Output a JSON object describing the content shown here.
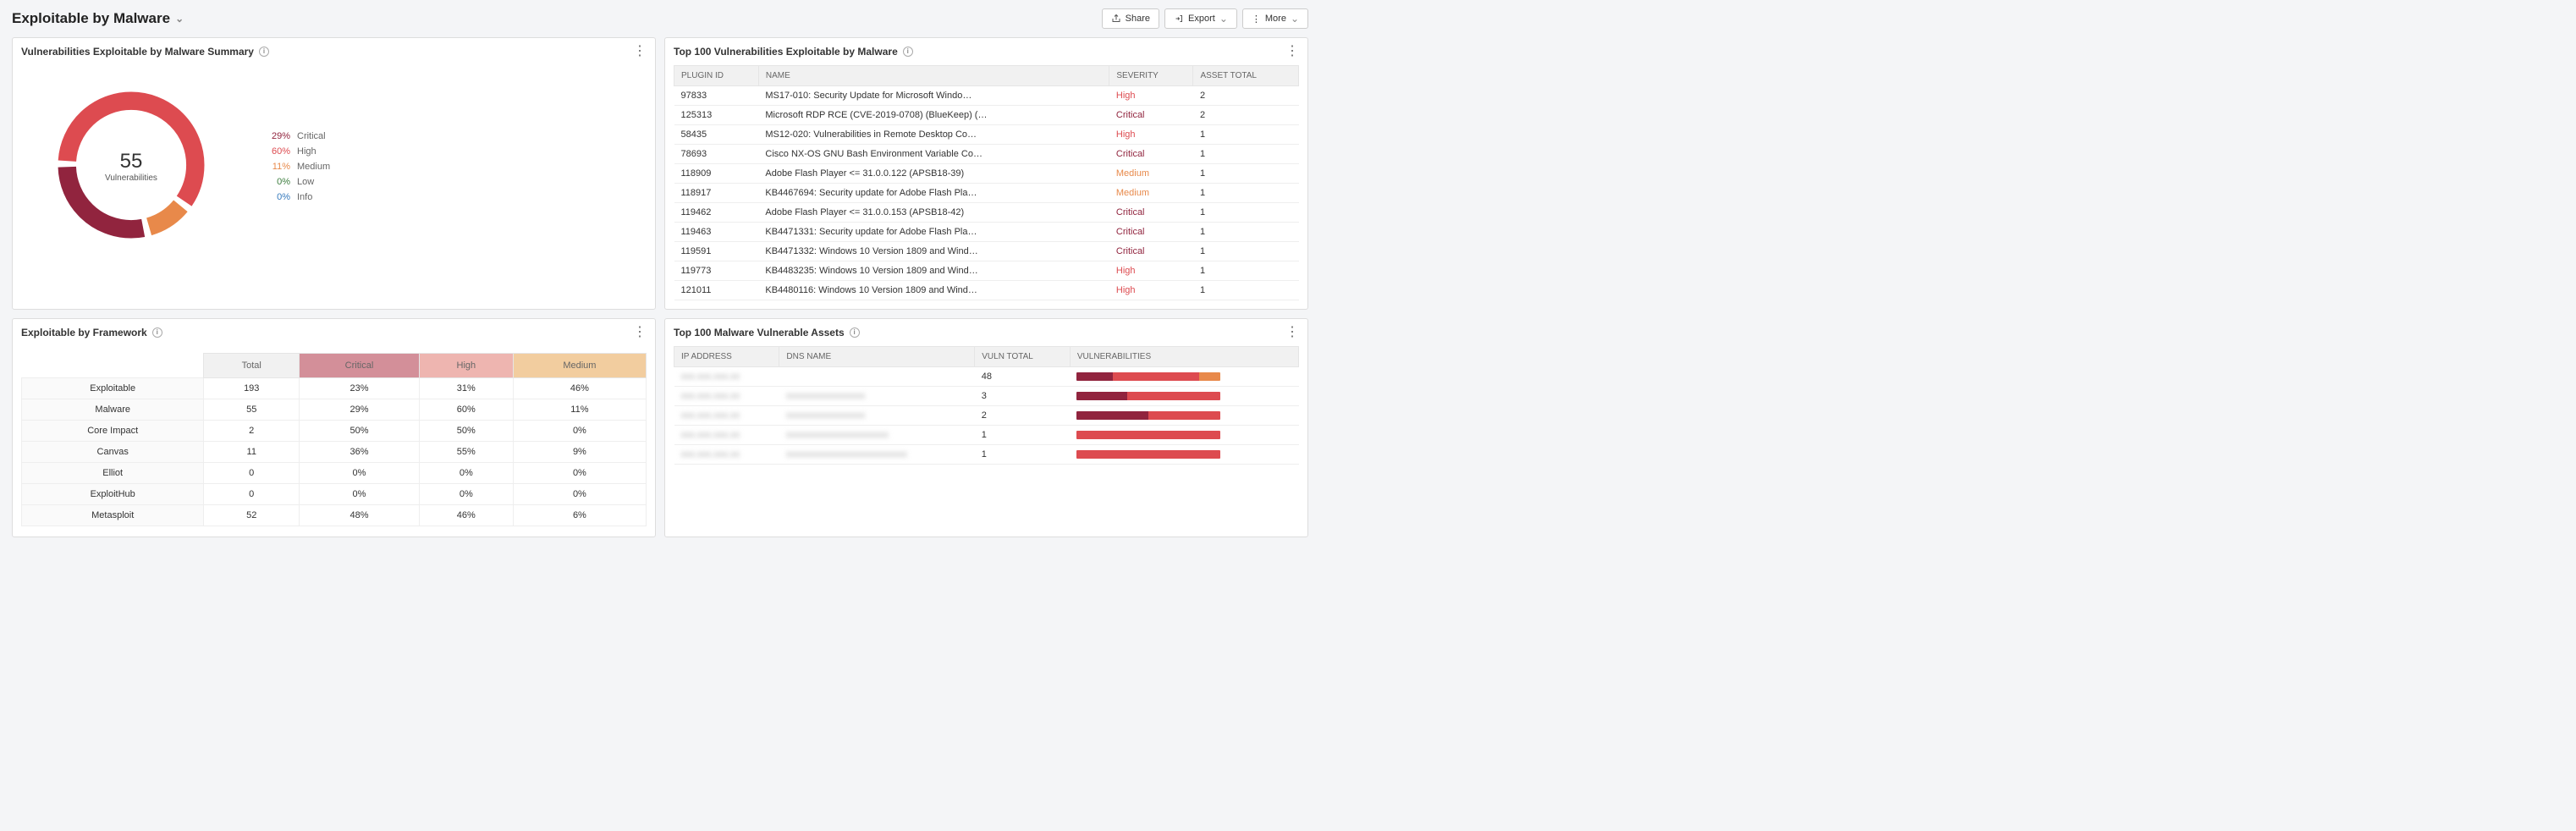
{
  "header": {
    "title": "Exploitable by Malware",
    "share": "Share",
    "export": "Export",
    "more": "More"
  },
  "colors": {
    "critical": "#91243e",
    "high": "#dd4b50",
    "medium": "#e8894a",
    "low": "#3c7d3e",
    "info": "#357abd"
  },
  "summaryPanel": {
    "title": "Vulnerabilities Exploitable by Malware Summary",
    "centerValue": "55",
    "centerLabel": "Vulnerabilities",
    "legend": [
      {
        "pct": "29%",
        "label": "Critical",
        "color": "#91243e"
      },
      {
        "pct": "60%",
        "label": "High",
        "color": "#dd4b50"
      },
      {
        "pct": "11%",
        "label": "Medium",
        "color": "#e8894a"
      },
      {
        "pct": "0%",
        "label": "Low",
        "color": "#3c7d3e"
      },
      {
        "pct": "0%",
        "label": "Info",
        "color": "#357abd"
      }
    ]
  },
  "top100Panel": {
    "title": "Top 100 Vulnerabilities Exploitable by Malware",
    "columns": [
      "PLUGIN ID",
      "NAME",
      "SEVERITY",
      "ASSET TOTAL"
    ],
    "rows": [
      {
        "pluginId": "97833",
        "name": "MS17-010: Security Update for Microsoft Windo…",
        "severity": "High",
        "assetTotal": "2"
      },
      {
        "pluginId": "125313",
        "name": "Microsoft RDP RCE (CVE-2019-0708) (BlueKeep) (…",
        "severity": "Critical",
        "assetTotal": "2"
      },
      {
        "pluginId": "58435",
        "name": "MS12-020: Vulnerabilities in Remote Desktop Co…",
        "severity": "High",
        "assetTotal": "1"
      },
      {
        "pluginId": "78693",
        "name": "Cisco NX-OS GNU Bash Environment Variable Co…",
        "severity": "Critical",
        "assetTotal": "1"
      },
      {
        "pluginId": "118909",
        "name": "Adobe Flash Player <= 31.0.0.122 (APSB18-39)",
        "severity": "Medium",
        "assetTotal": "1"
      },
      {
        "pluginId": "118917",
        "name": "KB4467694: Security update for Adobe Flash Pla…",
        "severity": "Medium",
        "assetTotal": "1"
      },
      {
        "pluginId": "119462",
        "name": "Adobe Flash Player <= 31.0.0.153 (APSB18-42)",
        "severity": "Critical",
        "assetTotal": "1"
      },
      {
        "pluginId": "119463",
        "name": "KB4471331: Security update for Adobe Flash Pla…",
        "severity": "Critical",
        "assetTotal": "1"
      },
      {
        "pluginId": "119591",
        "name": "KB4471332: Windows 10 Version 1809 and Wind…",
        "severity": "Critical",
        "assetTotal": "1"
      },
      {
        "pluginId": "119773",
        "name": "KB4483235: Windows 10 Version 1809 and Wind…",
        "severity": "High",
        "assetTotal": "1"
      },
      {
        "pluginId": "121011",
        "name": "KB4480116: Windows 10 Version 1809 and Wind…",
        "severity": "High",
        "assetTotal": "1"
      }
    ]
  },
  "frameworkPanel": {
    "title": "Exploitable by Framework",
    "columns": [
      "",
      "Total",
      "Critical",
      "High",
      "Medium"
    ],
    "rows": [
      {
        "label": "Exploitable",
        "total": "193",
        "crit": "23%",
        "high": "31%",
        "med": "46%"
      },
      {
        "label": "Malware",
        "total": "55",
        "crit": "29%",
        "high": "60%",
        "med": "11%"
      },
      {
        "label": "Core Impact",
        "total": "2",
        "crit": "50%",
        "high": "50%",
        "med": "0%"
      },
      {
        "label": "Canvas",
        "total": "11",
        "crit": "36%",
        "high": "55%",
        "med": "9%"
      },
      {
        "label": "Elliot",
        "total": "0",
        "crit": "0%",
        "high": "0%",
        "med": "0%"
      },
      {
        "label": "ExploitHub",
        "total": "0",
        "crit": "0%",
        "high": "0%",
        "med": "0%"
      },
      {
        "label": "Metasploit",
        "total": "52",
        "crit": "48%",
        "high": "46%",
        "med": "6%"
      }
    ]
  },
  "assetsPanel": {
    "title": "Top 100 Malware Vulnerable Assets",
    "columns": [
      "IP ADDRESS",
      "DNS NAME",
      "VULN TOTAL",
      "VULNERABILITIES"
    ],
    "rows": [
      {
        "ip": "xxx.xxx.xxx.xx",
        "dns": "",
        "vulnTotal": "48",
        "bar": [
          {
            "c": "#91243e",
            "w": 25
          },
          {
            "c": "#dd4b50",
            "w": 60
          },
          {
            "c": "#e8894a",
            "w": 15
          }
        ]
      },
      {
        "ip": "xxx.xxx.xxx.xx",
        "dns": "xxxxxxxxxxxxxxxxx",
        "vulnTotal": "3",
        "bar": [
          {
            "c": "#91243e",
            "w": 35
          },
          {
            "c": "#dd4b50",
            "w": 65
          }
        ]
      },
      {
        "ip": "xxx.xxx.xxx.xx",
        "dns": "xxxxxxxxxxxxxxxxx",
        "vulnTotal": "2",
        "bar": [
          {
            "c": "#91243e",
            "w": 50
          },
          {
            "c": "#dd4b50",
            "w": 50
          }
        ]
      },
      {
        "ip": "xxx.xxx.xxx.xx",
        "dns": "xxxxxxxxxxxxxxxxxxxxxx",
        "vulnTotal": "1",
        "bar": [
          {
            "c": "#dd4b50",
            "w": 100
          }
        ]
      },
      {
        "ip": "xxx.xxx.xxx.xx",
        "dns": "xxxxxxxxxxxxxxxxxxxxxxxxxx",
        "vulnTotal": "1",
        "bar": [
          {
            "c": "#dd4b50",
            "w": 100
          }
        ]
      }
    ]
  },
  "chart_data": {
    "type": "pie",
    "title": "Vulnerabilities Exploitable by Malware Summary",
    "categories": [
      "Critical",
      "High",
      "Medium",
      "Low",
      "Info"
    ],
    "values": [
      29,
      60,
      11,
      0,
      0
    ],
    "total": 55
  }
}
